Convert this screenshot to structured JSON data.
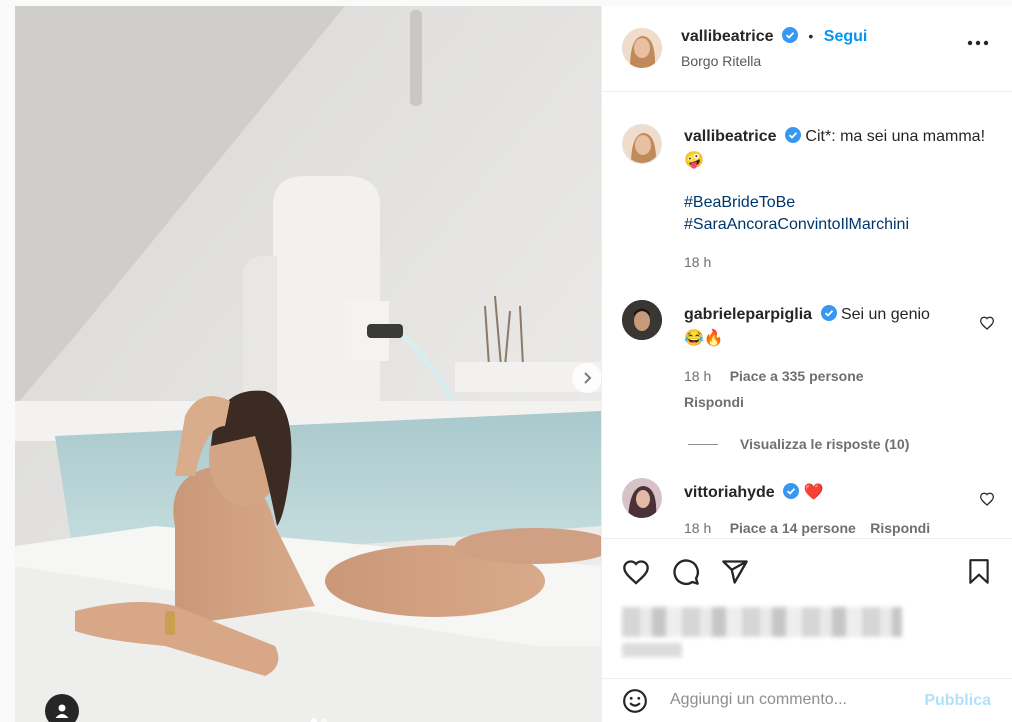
{
  "header": {
    "username": "vallibeatrice",
    "separator": "•",
    "follow_label": "Segui",
    "location": "Borgo Ritella"
  },
  "caption": {
    "username": "vallibeatrice",
    "text": "Cit*: ma sei una mamma!",
    "emoji": "🤪",
    "hashtags": [
      "#BeaBrideToBe",
      "#SaraAncoraConvintoIlMarchini"
    ],
    "time": "18 h"
  },
  "comments": [
    {
      "username": "gabrieleparpiglia",
      "text": "Sei un genio",
      "emoji": "😂🔥",
      "time": "18 h",
      "likes": "Piace a 335 persone",
      "reply_label": "Rispondi",
      "view_replies": "Visualizza le risposte (10)"
    },
    {
      "username": "vittoriahyde",
      "text": "",
      "emoji": "❤️",
      "time": "18 h",
      "likes": "Piace a 14 persone",
      "reply_label": "Rispondi"
    }
  ],
  "comment_box": {
    "placeholder": "Aggiungi un commento...",
    "publish_label": "Pubblica"
  },
  "colors": {
    "accent": "#0095f6",
    "verified": "#3897f0",
    "hashtag": "#00376b"
  },
  "icons": [
    "chevron-right-icon",
    "user-tag-icon",
    "more-icon",
    "verified-icon",
    "heart-icon",
    "comment-icon",
    "share-icon",
    "bookmark-icon",
    "emoji-icon"
  ]
}
